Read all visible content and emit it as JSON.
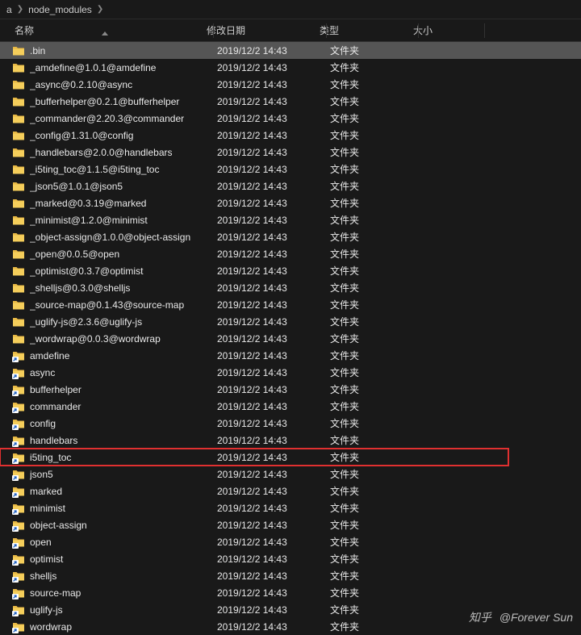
{
  "breadcrumb": {
    "part1": "a",
    "part2": "node_modules"
  },
  "headers": {
    "name": "名称",
    "date": "修改日期",
    "type": "类型",
    "size": "大小"
  },
  "rows": [
    {
      "icon": "folder",
      "name": ".bin",
      "date": "2019/12/2 14:43",
      "type": "文件夹",
      "selected": true
    },
    {
      "icon": "folder",
      "name": "_amdefine@1.0.1@amdefine",
      "date": "2019/12/2 14:43",
      "type": "文件夹"
    },
    {
      "icon": "folder",
      "name": "_async@0.2.10@async",
      "date": "2019/12/2 14:43",
      "type": "文件夹"
    },
    {
      "icon": "folder",
      "name": "_bufferhelper@0.2.1@bufferhelper",
      "date": "2019/12/2 14:43",
      "type": "文件夹"
    },
    {
      "icon": "folder",
      "name": "_commander@2.20.3@commander",
      "date": "2019/12/2 14:43",
      "type": "文件夹"
    },
    {
      "icon": "folder",
      "name": "_config@1.31.0@config",
      "date": "2019/12/2 14:43",
      "type": "文件夹"
    },
    {
      "icon": "folder",
      "name": "_handlebars@2.0.0@handlebars",
      "date": "2019/12/2 14:43",
      "type": "文件夹"
    },
    {
      "icon": "folder",
      "name": "_i5ting_toc@1.1.5@i5ting_toc",
      "date": "2019/12/2 14:43",
      "type": "文件夹"
    },
    {
      "icon": "folder",
      "name": "_json5@1.0.1@json5",
      "date": "2019/12/2 14:43",
      "type": "文件夹"
    },
    {
      "icon": "folder",
      "name": "_marked@0.3.19@marked",
      "date": "2019/12/2 14:43",
      "type": "文件夹"
    },
    {
      "icon": "folder",
      "name": "_minimist@1.2.0@minimist",
      "date": "2019/12/2 14:43",
      "type": "文件夹"
    },
    {
      "icon": "folder",
      "name": "_object-assign@1.0.0@object-assign",
      "date": "2019/12/2 14:43",
      "type": "文件夹"
    },
    {
      "icon": "folder",
      "name": "_open@0.0.5@open",
      "date": "2019/12/2 14:43",
      "type": "文件夹"
    },
    {
      "icon": "folder",
      "name": "_optimist@0.3.7@optimist",
      "date": "2019/12/2 14:43",
      "type": "文件夹"
    },
    {
      "icon": "folder",
      "name": "_shelljs@0.3.0@shelljs",
      "date": "2019/12/2 14:43",
      "type": "文件夹"
    },
    {
      "icon": "folder",
      "name": "_source-map@0.1.43@source-map",
      "date": "2019/12/2 14:43",
      "type": "文件夹"
    },
    {
      "icon": "folder",
      "name": "_uglify-js@2.3.6@uglify-js",
      "date": "2019/12/2 14:43",
      "type": "文件夹"
    },
    {
      "icon": "folder",
      "name": "_wordwrap@0.0.3@wordwrap",
      "date": "2019/12/2 14:43",
      "type": "文件夹"
    },
    {
      "icon": "shortcut",
      "name": "amdefine",
      "date": "2019/12/2 14:43",
      "type": "文件夹"
    },
    {
      "icon": "shortcut",
      "name": "async",
      "date": "2019/12/2 14:43",
      "type": "文件夹"
    },
    {
      "icon": "shortcut",
      "name": "bufferhelper",
      "date": "2019/12/2 14:43",
      "type": "文件夹"
    },
    {
      "icon": "shortcut",
      "name": "commander",
      "date": "2019/12/2 14:43",
      "type": "文件夹"
    },
    {
      "icon": "shortcut",
      "name": "config",
      "date": "2019/12/2 14:43",
      "type": "文件夹"
    },
    {
      "icon": "shortcut",
      "name": "handlebars",
      "date": "2019/12/2 14:43",
      "type": "文件夹"
    },
    {
      "icon": "shortcut",
      "name": "i5ting_toc",
      "date": "2019/12/2 14:43",
      "type": "文件夹",
      "highlighted": true
    },
    {
      "icon": "shortcut",
      "name": "json5",
      "date": "2019/12/2 14:43",
      "type": "文件夹"
    },
    {
      "icon": "shortcut",
      "name": "marked",
      "date": "2019/12/2 14:43",
      "type": "文件夹"
    },
    {
      "icon": "shortcut",
      "name": "minimist",
      "date": "2019/12/2 14:43",
      "type": "文件夹"
    },
    {
      "icon": "shortcut",
      "name": "object-assign",
      "date": "2019/12/2 14:43",
      "type": "文件夹"
    },
    {
      "icon": "shortcut",
      "name": "open",
      "date": "2019/12/2 14:43",
      "type": "文件夹"
    },
    {
      "icon": "shortcut",
      "name": "optimist",
      "date": "2019/12/2 14:43",
      "type": "文件夹"
    },
    {
      "icon": "shortcut",
      "name": "shelljs",
      "date": "2019/12/2 14:43",
      "type": "文件夹"
    },
    {
      "icon": "shortcut",
      "name": "source-map",
      "date": "2019/12/2 14:43",
      "type": "文件夹"
    },
    {
      "icon": "shortcut",
      "name": "uglify-js",
      "date": "2019/12/2 14:43",
      "type": "文件夹"
    },
    {
      "icon": "shortcut",
      "name": "wordwrap",
      "date": "2019/12/2 14:43",
      "type": "文件夹"
    }
  ],
  "watermark": {
    "brand": "知乎",
    "user": "@Forever Sun"
  }
}
